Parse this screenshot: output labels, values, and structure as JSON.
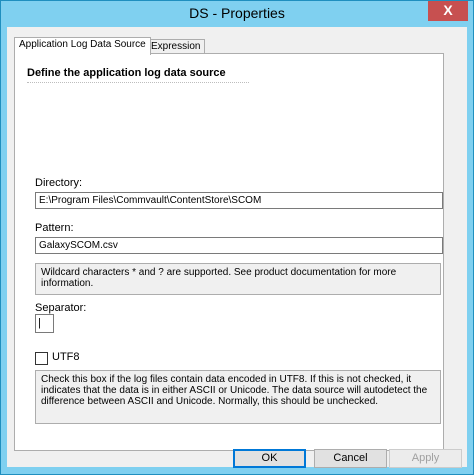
{
  "window": {
    "title": "DS - Properties",
    "close_glyph": "X"
  },
  "tabs": [
    {
      "label": "Application Log Data Source",
      "active": true
    },
    {
      "label": "Expression",
      "active": false
    }
  ],
  "section": {
    "title": "Define the application log data source"
  },
  "directory": {
    "label": "Directory:",
    "value": "E:\\Program Files\\Commvault\\ContentStore\\SCOM"
  },
  "pattern": {
    "label": "Pattern:",
    "value": "GalaxySCOM.csv",
    "help": "Wildcard characters * and ? are supported. See product documentation for more information."
  },
  "separator": {
    "label": "Separator:",
    "value": "|"
  },
  "utf8": {
    "label": "UTF8",
    "checked": false,
    "help": "Check this box if the log files contain data encoded in UTF8. If this is not checked, it indicates that the data is in either ASCII or Unicode. The data source will autodetect the difference between ASCII and Unicode. Normally, this should be unchecked."
  },
  "buttons": {
    "ok": "OK",
    "cancel": "Cancel",
    "apply": "Apply"
  }
}
